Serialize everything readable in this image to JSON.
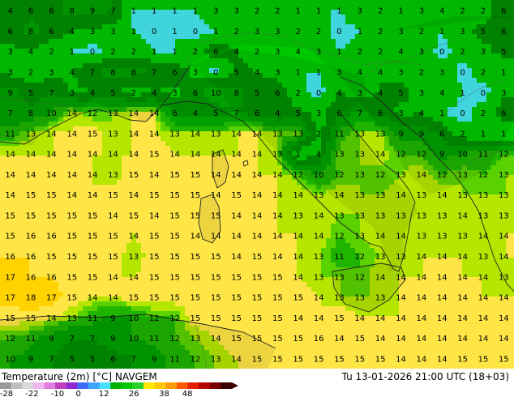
{
  "map": {
    "parameter": "Temperature (2m) [°C]",
    "model": "NAVGEM",
    "valid_time": "Tu 13-01-2026 21:00 UTC (18+03)",
    "value_grid": [
      "4 6 6 8 9 7 1 1 1 1 3 3 2 2 1 1 1 3 2 1 3 4 2 2 6",
      "6 8 6 4 3 3 1 0 1 0 1 2 3 3 2 2 0 1 2 3 2 1 3 5 6",
      "3 4 2 1 0 2 2 1 1 2 6 4 2 3 4 3 1 2 2 4 3 0 2 3 5",
      "3 2 3 4 7 8 8 7 6 3 0 5 4 3 1 1 3 4 4 3 2 3 0 2 1",
      "9 5 7 3 4 5 2 4 3 6 10 8 5 6 2 0 4 3 4 5 3 4 1 0 3",
      "7 8 10 14 12 13 14 14 6 4 5 7 6 4 5 3 6 7 6 3 4 1 0 2 6",
      "11 13 14 14 15 13 14 14 13 14 13 14 14 13 13 2 11 13 13 9 9 6 2 1 1",
      "14 14 14 14 14 14 14 15 14 14 14 14 14 13 1 4 13 13 14 12 12 9 10 11 12",
      "14 14 14 14 14 13 15 14 15 15 14 14 14 14 12 10 12 13 12 13 14 12 13 12 13",
      "14 15 15 14 14 15 14 15 15 15 14 15 14 14 14 13 14 13 13 14 13 14 13 13 13",
      "15 15 15 15 15 14 15 14 15 15 15 14 14 14 13 14 13 13 13 13 13 13 14 13 13",
      "15 16 16 15 15 15 14 15 15 14 14 14 14 14 14 14 12 13 14 14 13 13 13 14 14",
      "16 16 15 15 15 15 13 15 15 15 15 14 15 14 14 13 11 12 13 13 14 14 14 13 14",
      "17 16 16 15 15 14 14 15 15 15 15 15 15 15 14 13 13 12 14 14 14 14 14 14 13",
      "17 18 17 15 14 14 15 15 15 15 15 15 15 15 15 14 13 13 13 14 14 14 14 14 14",
      "15 15 14 13 11 9 10 12 12 15 15 15 15 15 14 14 15 14 14 14 14 14 14 14 14",
      "12 11 9 7 7 9 10 11 12 13 14 15 15 15 15 16 14 15 14 14 14 14 14 14 14",
      "10 9 7 5 5 6 7 9 11 12 13 14 15 15 15 15 15 15 15 14 14 14 15 15 15"
    ],
    "color_breaks": [
      [
        -28,
        "#ffffff"
      ],
      [
        -24,
        "#e1dcff"
      ],
      [
        -20,
        "#c8b4ff"
      ],
      [
        -16,
        "#9b64ff"
      ],
      [
        -13,
        "#782dc8"
      ],
      [
        -10,
        "#5a5aff"
      ],
      [
        -7,
        "#3c8cff"
      ],
      [
        -4,
        "#00b9ff"
      ],
      [
        -1,
        "#46e6f0"
      ],
      [
        1,
        "#00c800"
      ],
      [
        4,
        "#008c00"
      ],
      [
        7,
        "#00a000"
      ],
      [
        10,
        "#1eb400"
      ],
      [
        12,
        "#5ad200"
      ],
      [
        13,
        "#b4e600"
      ],
      [
        14,
        "#ffe646"
      ],
      [
        16,
        "#ffd200"
      ],
      [
        19,
        "#ffaa00"
      ],
      [
        22,
        "#ff7800"
      ],
      [
        26,
        "#ff3c00"
      ]
    ],
    "land_tint": "#00000014"
  },
  "scale": {
    "labels": [
      "-28",
      "-22",
      "-10",
      "0",
      "12",
      "26",
      "38",
      "48"
    ],
    "colors": [
      "#9a9a9a",
      "#bdbdbd",
      "#d9d9d9",
      "#f0b6f0",
      "#e07be0",
      "#c03ec0",
      "#8e2ad2",
      "#3d6bff",
      "#3ba4ff",
      "#48e0ff",
      "#00b000",
      "#00c800",
      "#28d228",
      "#ffe600",
      "#ffc800",
      "#ff9b00",
      "#ff5a00",
      "#e61e00",
      "#b40000",
      "#780000",
      "#3c0000"
    ]
  }
}
